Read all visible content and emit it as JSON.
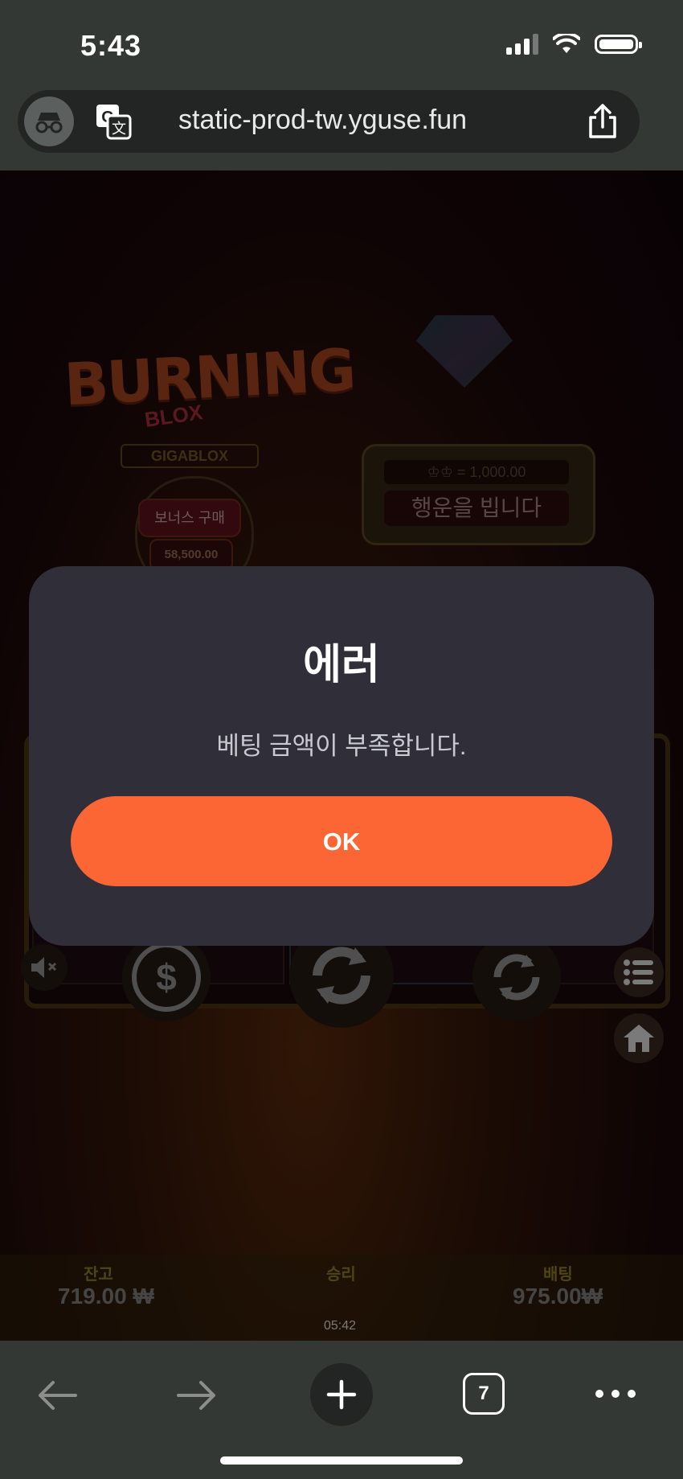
{
  "status_bar": {
    "time": "5:43"
  },
  "browser": {
    "url": "static-prod-tw.yguse.fun",
    "tab_count": "7"
  },
  "game": {
    "logo_title": "BURNING",
    "logo_subtitle": "BLOX",
    "logo_badge": "GIGABLOX",
    "bonus_buy_label": "보너스 구매",
    "bonus_buy_price": "58,500.00",
    "jackpot_value": "♔♔ = 1,000.00",
    "jackpot_message": "행운을 빕니다",
    "footer": {
      "balance_label": "잔고",
      "balance_value": "719.00 ₩",
      "win_label": "승리",
      "bet_label": "배팅",
      "bet_value": "975.00₩",
      "clock": "05:42"
    }
  },
  "dialog": {
    "title": "에러",
    "message": "베팅 금액이 부족합니다.",
    "ok_label": "OK",
    "ok_color": "#fc6634"
  },
  "icons": [
    "incognito-icon",
    "translate-icon",
    "share-icon",
    "mute-icon",
    "dollar-icon",
    "spin-icon",
    "autoplay-icon",
    "menu-icon",
    "home-icon",
    "back-icon",
    "forward-icon",
    "plus-icon",
    "more-icon"
  ]
}
